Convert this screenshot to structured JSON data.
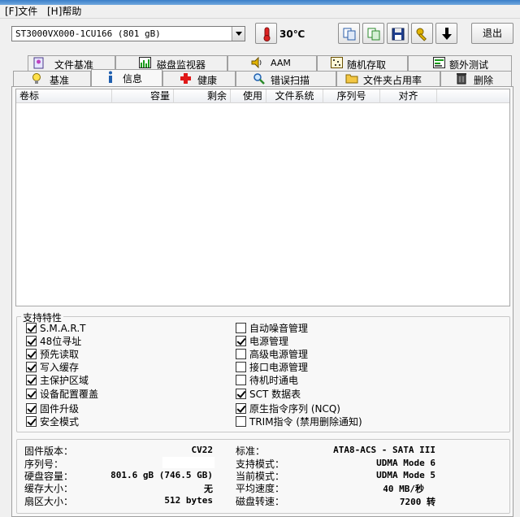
{
  "menu": {
    "file": "[F]文件",
    "help": "[H]帮助"
  },
  "toolbar": {
    "drive_select": "ST3000VX000-1CU166 (801 gB)",
    "temperature": "30℃",
    "exit_label": "退出"
  },
  "tabs_top": [
    {
      "label": "文件基准",
      "icon": "file-benchmark-icon"
    },
    {
      "label": "磁盘监视器",
      "icon": "disk-monitor-icon"
    },
    {
      "label": "AAM",
      "icon": "speaker-icon"
    },
    {
      "label": "随机存取",
      "icon": "random-access-icon"
    },
    {
      "label": "额外测试",
      "icon": "extra-tests-icon"
    }
  ],
  "tabs_bottom": [
    {
      "label": "基准",
      "icon": "benchmark-icon"
    },
    {
      "label": "信息",
      "icon": "info-icon",
      "active": true
    },
    {
      "label": "健康",
      "icon": "health-cross-icon"
    },
    {
      "label": "错误扫描",
      "icon": "magnifier-icon"
    },
    {
      "label": "文件夹占用率",
      "icon": "folder-icon"
    },
    {
      "label": "删除",
      "icon": "trash-icon"
    }
  ],
  "partition_table": {
    "columns": [
      "卷标",
      "容量",
      "剩余",
      "使用",
      "文件系统",
      "序列号",
      "对齐"
    ]
  },
  "features": {
    "title": "支持特性",
    "left": [
      {
        "label": "S.M.A.R.T",
        "checked": true
      },
      {
        "label": "48位寻址",
        "checked": true
      },
      {
        "label": "预先读取",
        "checked": true
      },
      {
        "label": "写入缓存",
        "checked": true
      },
      {
        "label": "主保护区域",
        "checked": true
      },
      {
        "label": "设备配置覆盖",
        "checked": true
      },
      {
        "label": "固件升级",
        "checked": true
      },
      {
        "label": "安全模式",
        "checked": true
      }
    ],
    "right": [
      {
        "label": "自动噪音管理",
        "checked": false
      },
      {
        "label": "电源管理",
        "checked": true
      },
      {
        "label": "高级电源管理",
        "checked": false
      },
      {
        "label": "接口电源管理",
        "checked": false
      },
      {
        "label": "待机时通电",
        "checked": false
      },
      {
        "label": "SCT 数据表",
        "checked": true
      },
      {
        "label": "原生指令序列 (NCQ)",
        "checked": true
      },
      {
        "label": "TRIM指令 (禁用删除通知)",
        "checked": false
      }
    ]
  },
  "info": {
    "left": [
      {
        "key": "固件版本：",
        "value": "CV22"
      },
      {
        "key": "序列号：",
        "value": ""
      },
      {
        "key": "硬盘容量：",
        "value": "801.6 gB (746.5 GB)"
      },
      {
        "key": "缓存大小：",
        "value": "无"
      },
      {
        "key": "扇区大小：",
        "value": "512 bytes"
      }
    ],
    "right": [
      {
        "key": "标准：",
        "value": "ATA8-ACS - SATA III"
      },
      {
        "key": "支持模式：",
        "value": "UDMA Mode 6"
      },
      {
        "key": "当前模式：",
        "value": "UDMA Mode 5"
      },
      {
        "key": "平均速度：",
        "value": "40 MB/秒"
      },
      {
        "key": "磁盘转速：",
        "value": "7200 转"
      }
    ]
  }
}
